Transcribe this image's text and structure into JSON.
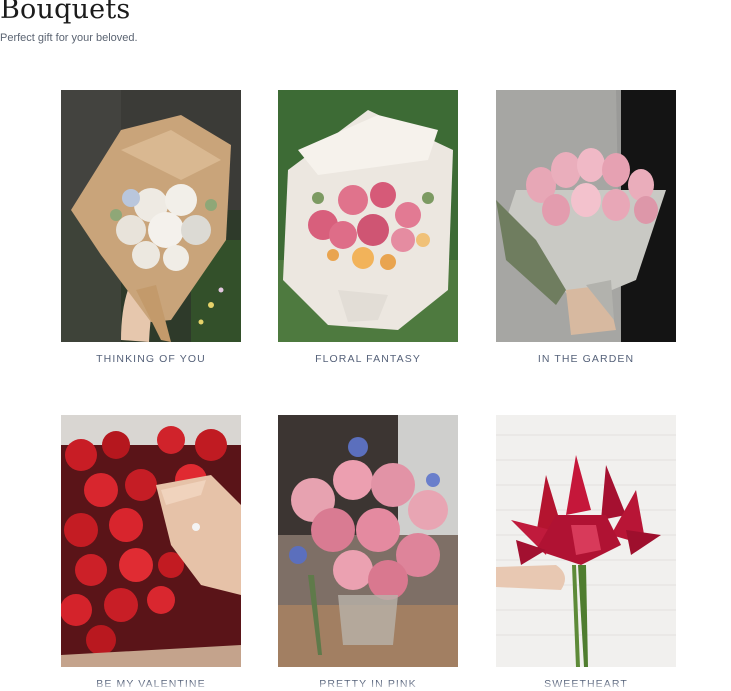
{
  "header": {
    "title": "Bouquets",
    "subtitle": "Perfect gift for your beloved."
  },
  "products": [
    {
      "name": "THINKING OF YOU"
    },
    {
      "name": "FLORAL FANTASY"
    },
    {
      "name": "IN THE GARDEN"
    },
    {
      "name": "BE MY VALENTINE"
    },
    {
      "name": "PRETTY IN PINK"
    },
    {
      "name": "SWEETHEART"
    }
  ]
}
